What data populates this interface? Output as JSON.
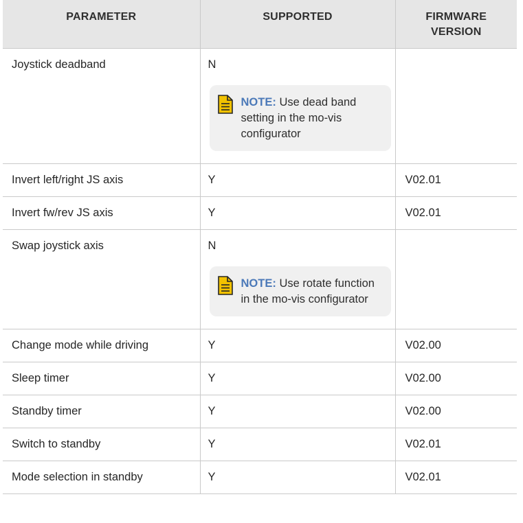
{
  "headers": [
    "PARAMETER",
    "SUPPORTED",
    "FIRMWARE VERSION"
  ],
  "rows": [
    {
      "parameter": "Joystick deadband",
      "supported": "N",
      "firmware": "",
      "note_label": "NOTE:",
      "note_text": "Use dead band setting in the mo-vis configurator"
    },
    {
      "parameter": "Invert left/right JS axis",
      "supported": "Y",
      "firmware": "V02.01"
    },
    {
      "parameter": "Invert fw/rev JS axis",
      "supported": "Y",
      "firmware": "V02.01"
    },
    {
      "parameter": "Swap joystick axis",
      "supported": "N",
      "firmware": "",
      "note_label": "NOTE:",
      "note_text": "Use rotate function in the mo-vis configurator"
    },
    {
      "parameter": "Change mode while driving",
      "supported": "Y",
      "firmware": "V02.00"
    },
    {
      "parameter": "Sleep timer",
      "supported": "Y",
      "firmware": "V02.00"
    },
    {
      "parameter": "Standby timer",
      "supported": "Y",
      "firmware": "V02.00"
    },
    {
      "parameter": "Switch to standby",
      "supported": "Y",
      "firmware": "V02.01"
    },
    {
      "parameter": "Mode selection in standby",
      "supported": "Y",
      "firmware": "V02.01"
    }
  ],
  "colors": {
    "header_bg": "#e6e6e6",
    "note_bg": "#f0f0f0",
    "note_label": "#4b79b8",
    "note_icon": "#f2c200"
  },
  "icons": {
    "note": "note-document-icon"
  }
}
